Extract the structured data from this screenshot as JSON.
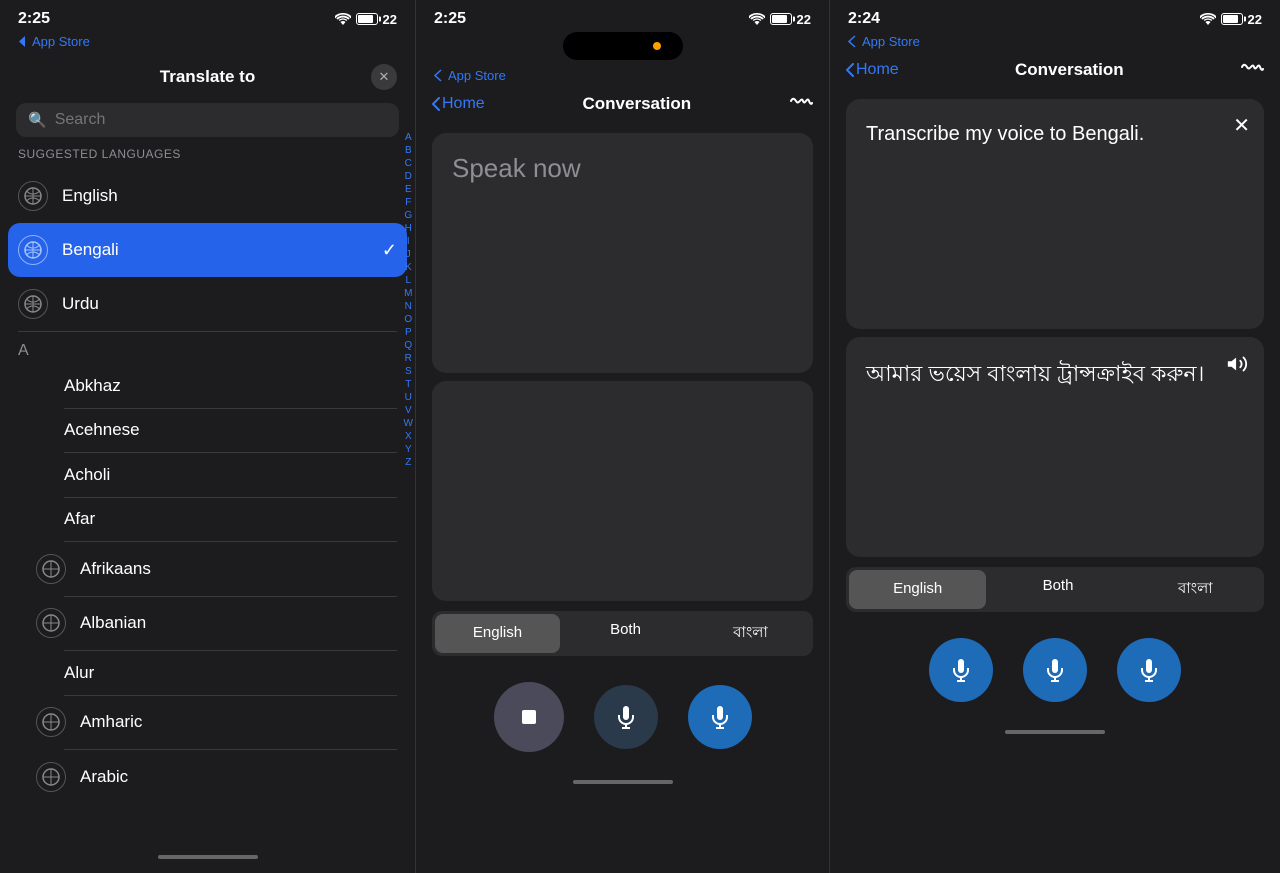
{
  "phone1": {
    "statusTime": "2:25",
    "statusBattery": "22",
    "storeLabel": "App Store",
    "header": {
      "title": "Translate to",
      "closeLabel": "×"
    },
    "search": {
      "placeholder": "Search"
    },
    "suggestedSection": "SUGGESTED LANGUAGES",
    "suggestedLanguages": [
      {
        "name": "English",
        "icon": "⊙",
        "selected": false
      },
      {
        "name": "Bengali",
        "icon": "⊙",
        "selected": true
      },
      {
        "name": "Urdu",
        "icon": "⊙",
        "selected": false
      }
    ],
    "alphabetSection": "A",
    "alphabetLanguages": [
      {
        "name": "Abkhaz",
        "hasIcon": false
      },
      {
        "name": "Acehnese",
        "hasIcon": false
      },
      {
        "name": "Acholi",
        "hasIcon": false
      },
      {
        "name": "Afar",
        "hasIcon": false
      },
      {
        "name": "Afrikaans",
        "hasIcon": true
      },
      {
        "name": "Albanian",
        "hasIcon": true
      },
      {
        "name": "Alur",
        "hasIcon": false
      },
      {
        "name": "Amharic",
        "hasIcon": true
      },
      {
        "name": "Arabic",
        "hasIcon": true
      }
    ],
    "alphaIndex": [
      "A",
      "B",
      "C",
      "D",
      "E",
      "F",
      "G",
      "H",
      "I",
      "J",
      "K",
      "L",
      "M",
      "N",
      "O",
      "P",
      "Q",
      "R",
      "S",
      "T",
      "U",
      "V",
      "W",
      "X",
      "Y",
      "Z"
    ]
  },
  "phone2": {
    "statusTime": "2:25",
    "statusBattery": "22",
    "storeLabel": "App Store",
    "nav": {
      "back": "Home",
      "title": "Conversation"
    },
    "speakNow": "Speak now",
    "toggleButtons": [
      {
        "label": "English",
        "active": true
      },
      {
        "label": "Both",
        "active": false
      },
      {
        "label": "বাংলা",
        "active": false
      }
    ]
  },
  "phone3": {
    "statusTime": "2:24",
    "statusBattery": "22",
    "storeLabel": "App Store",
    "nav": {
      "back": "Home",
      "title": "Conversation"
    },
    "translationEnglish": "Transcribe my voice to Bengali.",
    "translationBengali": "আমার ভয়েস বাংলায় ট্রান্সক্রাইব করুন।",
    "toggleButtons": [
      {
        "label": "English",
        "active": true
      },
      {
        "label": "Both",
        "active": false
      },
      {
        "label": "বাংলা",
        "active": false
      }
    ]
  }
}
